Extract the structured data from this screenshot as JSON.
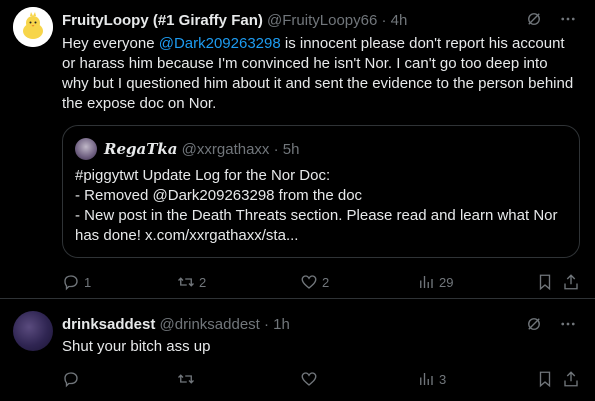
{
  "tweet1": {
    "name": "FruityLoopy (#1 Giraffy Fan)",
    "handle": "@FruityLoopy66",
    "sep": "·",
    "time": "4h",
    "text_pre": "Hey everyone ",
    "mention": "@Dark209263298",
    "text_post": " is innocent please don't report his account or harass him because I'm convinced he isn't Nor. I can't go too deep into why but I questioned him about it and sent the evidence to the person behind the expose doc on Nor.",
    "quote": {
      "name": "RegaTka",
      "handle": "@xxrgathaxx",
      "time": "5h",
      "lines": [
        "#piggytwt Update Log for the Nor Doc:",
        "- Removed @Dark209263298 from the doc",
        "- New post in the Death Threats section. Please read and learn what Nor has done! x.com/xxrgathaxx/sta..."
      ]
    },
    "actions": {
      "replies": "1",
      "reposts": "2",
      "likes": "2",
      "views": "29"
    }
  },
  "tweet2": {
    "name": "drinksaddest",
    "handle": "@drinksaddest",
    "sep": "·",
    "time": "1h",
    "text": "Shut your bitch ass up",
    "actions": {
      "replies": "",
      "reposts": "",
      "likes": "",
      "views": "3"
    }
  },
  "icons": {
    "grok": "grok-icon",
    "more": "more-icon",
    "reply": "reply-icon",
    "repost": "repost-icon",
    "like": "heart-icon",
    "views": "views-icon",
    "bookmark": "bookmark-icon",
    "share": "share-icon"
  },
  "colors": {
    "background": "#000000",
    "text": "#e7e9ea",
    "muted": "#71767b",
    "accent": "#1d9bf0",
    "border": "#2f3336"
  }
}
